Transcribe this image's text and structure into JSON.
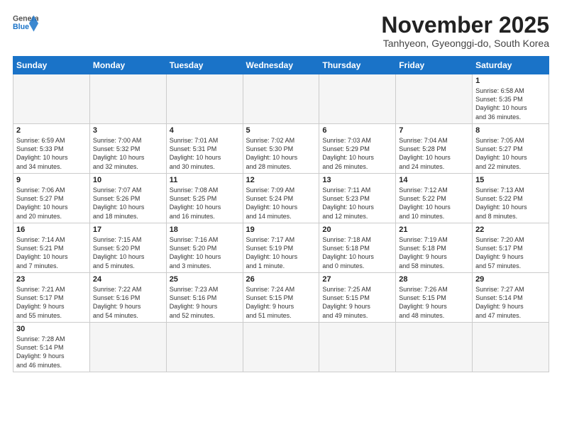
{
  "header": {
    "logo_general": "General",
    "logo_blue": "Blue",
    "month_title": "November 2025",
    "subtitle": "Tanhyeon, Gyeonggi-do, South Korea"
  },
  "weekdays": [
    "Sunday",
    "Monday",
    "Tuesday",
    "Wednesday",
    "Thursday",
    "Friday",
    "Saturday"
  ],
  "weeks": [
    [
      {
        "day": "",
        "info": ""
      },
      {
        "day": "",
        "info": ""
      },
      {
        "day": "",
        "info": ""
      },
      {
        "day": "",
        "info": ""
      },
      {
        "day": "",
        "info": ""
      },
      {
        "day": "",
        "info": ""
      },
      {
        "day": "1",
        "info": "Sunrise: 6:58 AM\nSunset: 5:35 PM\nDaylight: 10 hours\nand 36 minutes."
      }
    ],
    [
      {
        "day": "2",
        "info": "Sunrise: 6:59 AM\nSunset: 5:33 PM\nDaylight: 10 hours\nand 34 minutes."
      },
      {
        "day": "3",
        "info": "Sunrise: 7:00 AM\nSunset: 5:32 PM\nDaylight: 10 hours\nand 32 minutes."
      },
      {
        "day": "4",
        "info": "Sunrise: 7:01 AM\nSunset: 5:31 PM\nDaylight: 10 hours\nand 30 minutes."
      },
      {
        "day": "5",
        "info": "Sunrise: 7:02 AM\nSunset: 5:30 PM\nDaylight: 10 hours\nand 28 minutes."
      },
      {
        "day": "6",
        "info": "Sunrise: 7:03 AM\nSunset: 5:29 PM\nDaylight: 10 hours\nand 26 minutes."
      },
      {
        "day": "7",
        "info": "Sunrise: 7:04 AM\nSunset: 5:28 PM\nDaylight: 10 hours\nand 24 minutes."
      },
      {
        "day": "8",
        "info": "Sunrise: 7:05 AM\nSunset: 5:27 PM\nDaylight: 10 hours\nand 22 minutes."
      }
    ],
    [
      {
        "day": "9",
        "info": "Sunrise: 7:06 AM\nSunset: 5:27 PM\nDaylight: 10 hours\nand 20 minutes."
      },
      {
        "day": "10",
        "info": "Sunrise: 7:07 AM\nSunset: 5:26 PM\nDaylight: 10 hours\nand 18 minutes."
      },
      {
        "day": "11",
        "info": "Sunrise: 7:08 AM\nSunset: 5:25 PM\nDaylight: 10 hours\nand 16 minutes."
      },
      {
        "day": "12",
        "info": "Sunrise: 7:09 AM\nSunset: 5:24 PM\nDaylight: 10 hours\nand 14 minutes."
      },
      {
        "day": "13",
        "info": "Sunrise: 7:11 AM\nSunset: 5:23 PM\nDaylight: 10 hours\nand 12 minutes."
      },
      {
        "day": "14",
        "info": "Sunrise: 7:12 AM\nSunset: 5:22 PM\nDaylight: 10 hours\nand 10 minutes."
      },
      {
        "day": "15",
        "info": "Sunrise: 7:13 AM\nSunset: 5:22 PM\nDaylight: 10 hours\nand 8 minutes."
      }
    ],
    [
      {
        "day": "16",
        "info": "Sunrise: 7:14 AM\nSunset: 5:21 PM\nDaylight: 10 hours\nand 7 minutes."
      },
      {
        "day": "17",
        "info": "Sunrise: 7:15 AM\nSunset: 5:20 PM\nDaylight: 10 hours\nand 5 minutes."
      },
      {
        "day": "18",
        "info": "Sunrise: 7:16 AM\nSunset: 5:20 PM\nDaylight: 10 hours\nand 3 minutes."
      },
      {
        "day": "19",
        "info": "Sunrise: 7:17 AM\nSunset: 5:19 PM\nDaylight: 10 hours\nand 1 minute."
      },
      {
        "day": "20",
        "info": "Sunrise: 7:18 AM\nSunset: 5:18 PM\nDaylight: 10 hours\nand 0 minutes."
      },
      {
        "day": "21",
        "info": "Sunrise: 7:19 AM\nSunset: 5:18 PM\nDaylight: 9 hours\nand 58 minutes."
      },
      {
        "day": "22",
        "info": "Sunrise: 7:20 AM\nSunset: 5:17 PM\nDaylight: 9 hours\nand 57 minutes."
      }
    ],
    [
      {
        "day": "23",
        "info": "Sunrise: 7:21 AM\nSunset: 5:17 PM\nDaylight: 9 hours\nand 55 minutes."
      },
      {
        "day": "24",
        "info": "Sunrise: 7:22 AM\nSunset: 5:16 PM\nDaylight: 9 hours\nand 54 minutes."
      },
      {
        "day": "25",
        "info": "Sunrise: 7:23 AM\nSunset: 5:16 PM\nDaylight: 9 hours\nand 52 minutes."
      },
      {
        "day": "26",
        "info": "Sunrise: 7:24 AM\nSunset: 5:15 PM\nDaylight: 9 hours\nand 51 minutes."
      },
      {
        "day": "27",
        "info": "Sunrise: 7:25 AM\nSunset: 5:15 PM\nDaylight: 9 hours\nand 49 minutes."
      },
      {
        "day": "28",
        "info": "Sunrise: 7:26 AM\nSunset: 5:15 PM\nDaylight: 9 hours\nand 48 minutes."
      },
      {
        "day": "29",
        "info": "Sunrise: 7:27 AM\nSunset: 5:14 PM\nDaylight: 9 hours\nand 47 minutes."
      }
    ],
    [
      {
        "day": "30",
        "info": "Sunrise: 7:28 AM\nSunset: 5:14 PM\nDaylight: 9 hours\nand 46 minutes."
      },
      {
        "day": "",
        "info": ""
      },
      {
        "day": "",
        "info": ""
      },
      {
        "day": "",
        "info": ""
      },
      {
        "day": "",
        "info": ""
      },
      {
        "day": "",
        "info": ""
      },
      {
        "day": "",
        "info": ""
      }
    ]
  ]
}
